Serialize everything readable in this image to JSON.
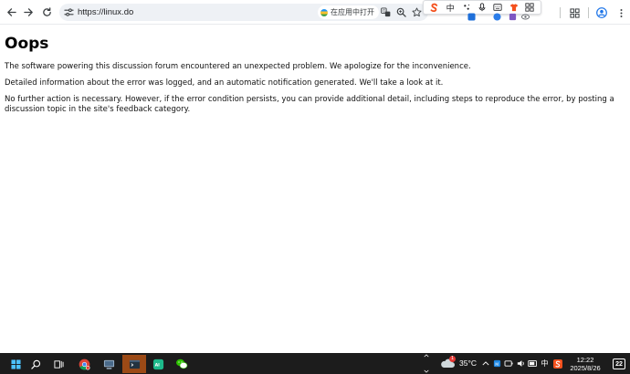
{
  "browser": {
    "url": "https://linux.do",
    "open_in_app_label": "在应用中打开",
    "ime": {
      "mode_label": "中"
    }
  },
  "page": {
    "heading": "Oops",
    "paragraphs": [
      "The software powering this discussion forum encountered an unexpected problem. We apologize for the inconvenience.",
      "Detailed information about the error was logged, and an automatic notification generated. We'll take a look at it.",
      "No further action is necessary. However, if the error condition persists, you can provide additional detail, including steps to reproduce the error, by posting a discussion topic in the site's feedback category."
    ]
  },
  "taskbar": {
    "weather_temp": "35°C",
    "weather_badge": "1",
    "ime_label": "中",
    "time": "12:22",
    "date": "2025/8/26",
    "notification_count": "22"
  },
  "colors": {
    "taskbar_bg": "#1c1c1c",
    "active_app": "#9c4a16",
    "omnibox_bg": "#eef1f5",
    "sogou_orange": "#f4511e"
  }
}
